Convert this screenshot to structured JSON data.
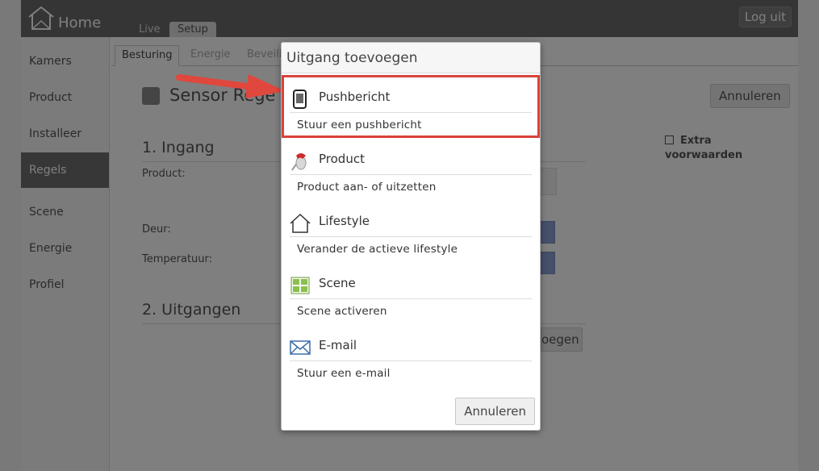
{
  "app": {
    "home_label": "Home",
    "top_tabs": {
      "live": "Live",
      "setup": "Setup"
    },
    "logout": "Log uit",
    "sidebar": {
      "items": [
        {
          "label": "Kamers"
        },
        {
          "label": "Product"
        },
        {
          "label": "Installeer"
        },
        {
          "label": "Regels"
        },
        {
          "label": "Scene"
        },
        {
          "label": "Energie"
        },
        {
          "label": "Profiel"
        }
      ],
      "active_index": 3
    },
    "subtabs": {
      "besturing": "Besturing",
      "energie": "Energie",
      "beveiliging": "Beveili"
    },
    "page_title": "Sensor Rege",
    "cancel": "Annuleren",
    "section1": "1. Ingang",
    "section2": "2. Uitgangen",
    "fields": {
      "product": "Product:",
      "deur": "Deur:",
      "temperatuur": "Temperatuur:"
    },
    "extra": {
      "line1": "Extra",
      "line2": "voorwaarden"
    },
    "add_button_partial": "oegen"
  },
  "modal": {
    "title": "Uitgang toevoegen",
    "options": [
      {
        "name": "Pushbericht",
        "description": "Stuur een pushbericht",
        "icon": "phone-icon"
      },
      {
        "name": "Product",
        "description": "Product aan- of uitzetten",
        "icon": "product-icon"
      },
      {
        "name": "Lifestyle",
        "description": "Verander de actieve lifestyle",
        "icon": "house-icon"
      },
      {
        "name": "Scene",
        "description": "Scene activeren",
        "icon": "scene-grid-icon"
      },
      {
        "name": "E-mail",
        "description": "Stuur een e-mail",
        "icon": "envelope-icon"
      }
    ],
    "cancel": "Annuleren",
    "highlighted_option": "Pushbericht"
  },
  "colors": {
    "highlight": "#d9433a",
    "sidebar_active": "#6e6e6e",
    "topbar": "#6b6b6b"
  }
}
